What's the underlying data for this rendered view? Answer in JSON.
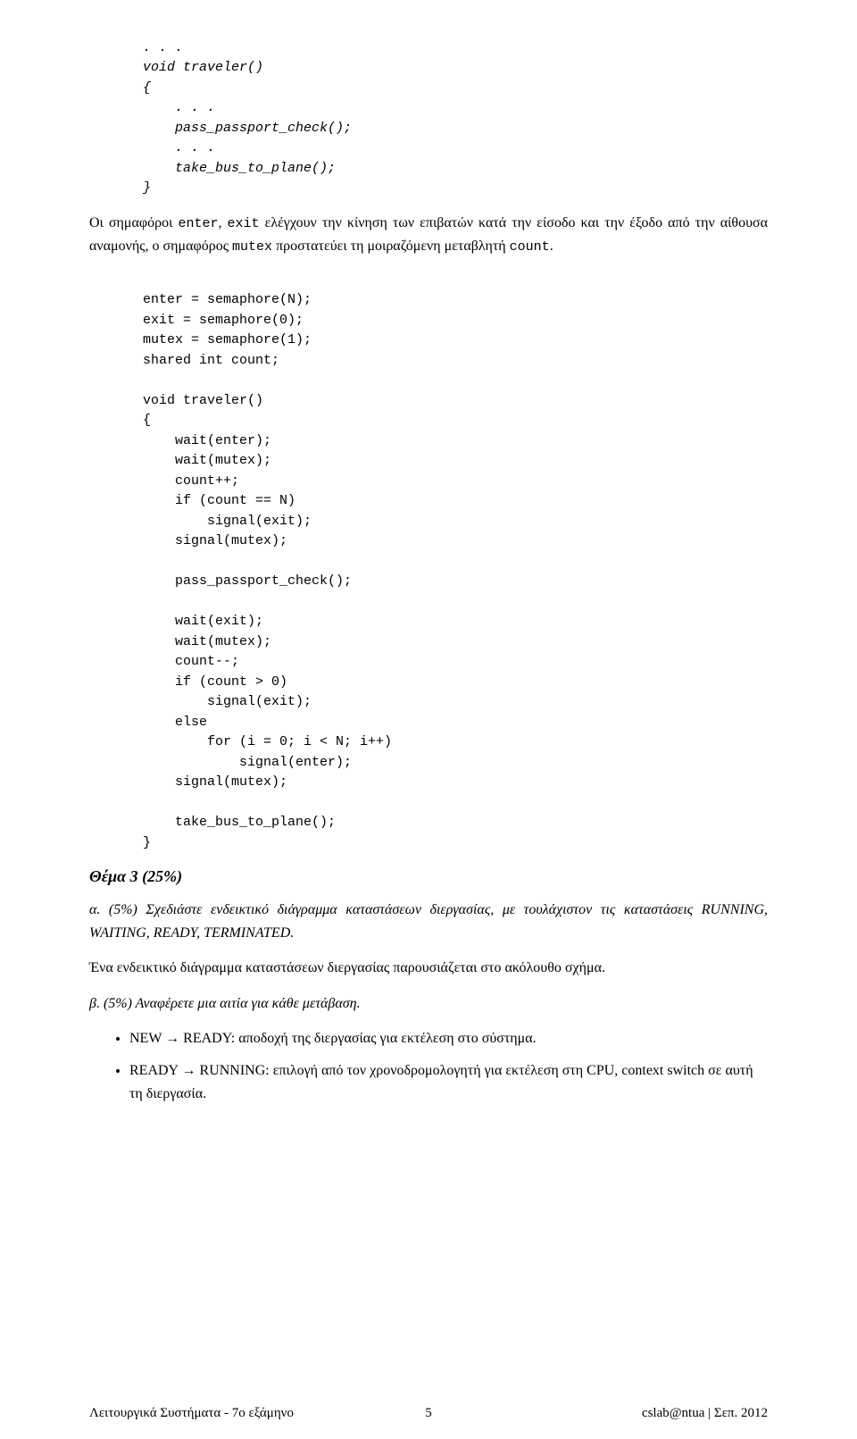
{
  "code1": {
    "l1": ". . .",
    "l2": "void traveler()",
    "l3": "{",
    "l4": "    . . .",
    "l5": "    pass_passport_check();",
    "l6": "    . . .",
    "l7": "    take_bus_to_plane();",
    "l8": "}"
  },
  "para1": {
    "t1": "Οι σημαφόροι ",
    "m1": "enter",
    "t2": ", ",
    "m2": "exit",
    "t3": " ελέγχουν την κίνηση των επιβατών κατά την είσοδο και την έξοδο από την αίθουσα αναμονής, ο σημαφόρος ",
    "m3": "mutex",
    "t4": " προστατεύει τη μοιραζόμενη μεταβλητή ",
    "m4": "count",
    "t5": "."
  },
  "code2": {
    "l1": "enter = semaphore(N);",
    "l2": "exit = semaphore(0);",
    "l3": "mutex = semaphore(1);",
    "l4": "shared int count;",
    "l5": "",
    "l6": "void traveler()",
    "l7": "{",
    "l8": "    wait(enter);",
    "l9": "    wait(mutex);",
    "l10": "    count++;",
    "l11": "    if (count == N)",
    "l12": "        signal(exit);",
    "l13": "    signal(mutex);",
    "l14": "",
    "l15": "    pass_passport_check();",
    "l16": "",
    "l17": "    wait(exit);",
    "l18": "    wait(mutex);",
    "l19": "    count--;",
    "l20": "    if (count > 0)",
    "l21": "        signal(exit);",
    "l22": "    else",
    "l23": "        for (i = 0; i < N; i++)",
    "l24": "            signal(enter);",
    "l25": "    signal(mutex);",
    "l26": "",
    "l27": "    take_bus_to_plane();",
    "l28": "}"
  },
  "thema": "Θέμα 3 (25%)",
  "qa": {
    "label": "α. (5%)",
    "text": "   Σχεδιάστε ενδεικτικό διάγραμμα καταστάσεων διεργασίας, με τουλάχιστον τις καταστάσεις RUNNING, WAITING, READY, TERMINATED."
  },
  "para2": "Ένα ενδεικτικό διάγραμμα καταστάσεων διεργασίας παρουσιάζεται στο ακόλουθο σχήμα.",
  "qb": {
    "label": "β. (5%)",
    "text": "   Αναφέρετε μια αιτία για κάθε μετάβαση."
  },
  "bullets": {
    "b1": "NEW → READY: αποδοχή της διεργασίας για εκτέλεση στο σύστημα.",
    "b2": "READY → RUNNING: επιλογή από τον χρονοδρομολογητή για εκτέλεση στη CPU, context switch σε αυτή τη διεργασία."
  },
  "footer": {
    "left": "Λειτουργικά Συστήματα - 7ο εξάμηνο",
    "center": "5",
    "right": "cslab@ntua | Σεπ. 2012"
  }
}
